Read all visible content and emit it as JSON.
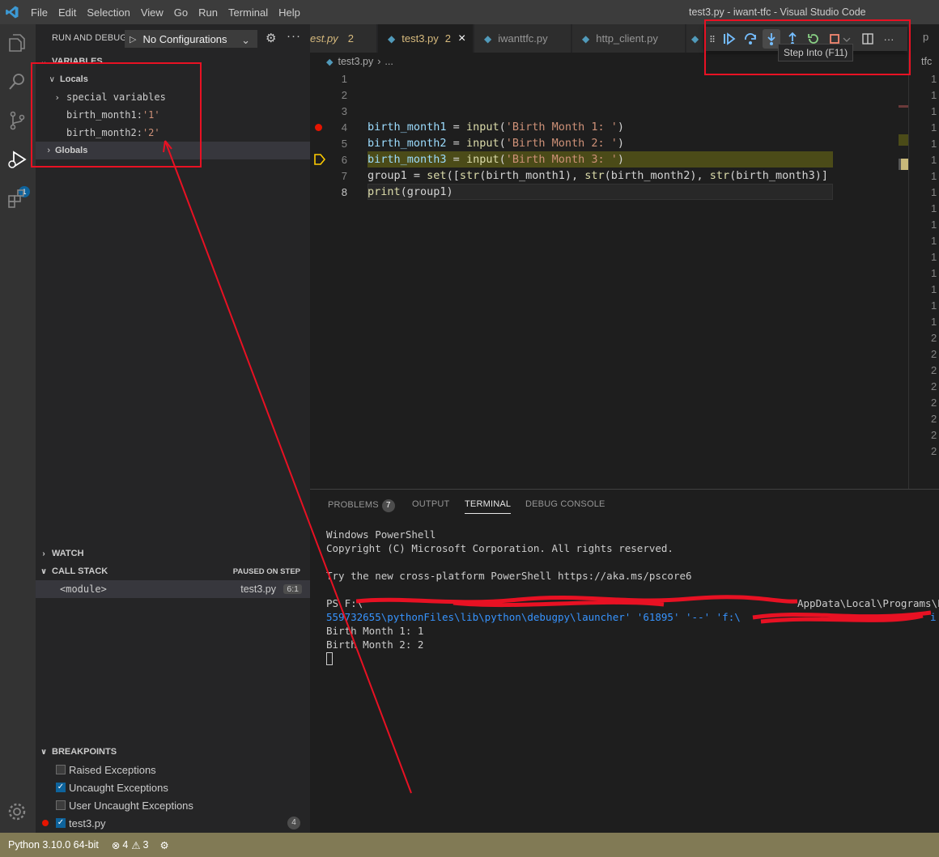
{
  "window": {
    "title": "test3.py - iwant-tfc - Visual Studio Code",
    "menu": [
      "File",
      "Edit",
      "Selection",
      "View",
      "Go",
      "Run",
      "Terminal",
      "Help"
    ]
  },
  "activity_bar": {
    "items": [
      "explorer-icon",
      "search-icon",
      "source-control-icon",
      "run-debug-icon",
      "extensions-icon"
    ],
    "debug_badge": "1",
    "settings": "gear-icon"
  },
  "sidebar": {
    "title": "RUN AND DEBUG",
    "config_label": "No Configurations",
    "variables_header": "VARIABLES",
    "locals_label": "Locals",
    "special_vars": "special variables",
    "variables": [
      {
        "name": "birth_month1",
        "value": "'1'"
      },
      {
        "name": "birth_month2",
        "value": "'2'"
      }
    ],
    "globals_label": "Globals",
    "watch_header": "WATCH",
    "callstack_header": "CALL STACK",
    "callstack_state": "PAUSED ON STEP",
    "frame": {
      "name": "<module>",
      "file": "test3.py",
      "pos": "6:1"
    },
    "breakpoints_header": "BREAKPOINTS",
    "breakpoints": [
      {
        "label": "Raised Exceptions",
        "checked": false
      },
      {
        "label": "Uncaught Exceptions",
        "checked": true
      },
      {
        "label": "User Uncaught Exceptions",
        "checked": false
      },
      {
        "label": "test3.py",
        "checked": true,
        "count": "4"
      }
    ]
  },
  "editor": {
    "tabs": [
      {
        "label": "est.py",
        "mod": "2"
      },
      {
        "label": "test3.py",
        "mod": "2",
        "close": "×"
      },
      {
        "label": "iwanttfc.py"
      },
      {
        "label": "http_client.py"
      }
    ],
    "breadcrumb": "test3.py",
    "breadcrumb_more": "...",
    "line_numbers": [
      "1",
      "2",
      "3",
      "4",
      "5",
      "6",
      "7",
      "8"
    ],
    "code": {
      "l4": [
        "birth_month1",
        " = ",
        "input",
        "(",
        "'Birth Month 1: '",
        ")"
      ],
      "l5": [
        "birth_month2",
        " = ",
        "input",
        "(",
        "'Birth Month 2: '",
        ")"
      ],
      "l6": [
        "birth_month3",
        " = ",
        "input",
        "(",
        "'Birth Month 3: '",
        ")"
      ],
      "l7_a": "group1",
      "l7_b": " = ",
      "l7_c": "set",
      "l7_d": "([",
      "l7_e": "str",
      "l7_f": "(birth_month1), ",
      "l7_g": "str",
      "l7_h": "(birth_month2), ",
      "l7_i": "str",
      "l7_j": "(birth_month3)]",
      "l8_a": "print",
      "l8_b": "(group1)"
    },
    "secondary_label": "tfc",
    "secondary_tab": "p",
    "secondary_lines": [
      "1",
      "1",
      "1",
      "1",
      "1",
      "1",
      "1",
      "1",
      "1",
      "1",
      "1",
      "1",
      "1",
      "1",
      "1",
      "1",
      "2",
      "2",
      "2",
      "2",
      "2",
      "2",
      "2",
      "2"
    ]
  },
  "debug_toolbar": {
    "buttons": [
      "drag-grip-icon",
      "continue-icon",
      "step-over-icon",
      "step-into-icon",
      "step-out-icon",
      "restart-icon",
      "stop-icon"
    ],
    "tooltip": "Step Into (F11)",
    "split_editor": "split-editor-icon",
    "more": "···"
  },
  "panel": {
    "tabs": [
      "PROBLEMS",
      "OUTPUT",
      "TERMINAL",
      "DEBUG CONSOLE"
    ],
    "problems_count": "7",
    "active_tab": "TERMINAL",
    "terminal_lines": [
      "Windows PowerShell",
      "Copyright (C) Microsoft Corporation. All rights reserved.",
      "",
      "Try the new cross-platform PowerShell https://aka.ms/pscore6",
      "",
      "PS F:\\",
      "559732655\\pythonFiles\\lib\\python\\debugpy\\launcher' '61895' '--' 'f:\\",
      "Birth Month 1: 1",
      "Birth Month 2: 2"
    ],
    "terminal_tail_1": "AppData\\Local\\Programs\\P",
    "terminal_tail_2": "i"
  },
  "statusbar": {
    "python": "Python 3.10.0 64-bit",
    "errors": "4",
    "warnings": "3"
  },
  "colors": {
    "annotation": "#e81123",
    "stop_line": "#4b4b18",
    "accent": "#0e639c"
  }
}
